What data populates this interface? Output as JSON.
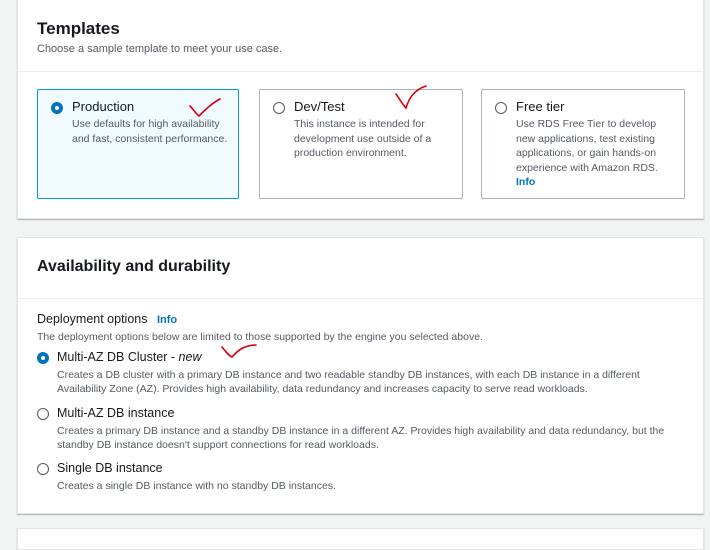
{
  "templates": {
    "title": "Templates",
    "subtitle": "Choose a sample template to meet your use case.",
    "options": [
      {
        "label": "Production",
        "description": "Use defaults for high availability and fast, consistent performance.",
        "selected": true
      },
      {
        "label": "Dev/Test",
        "description": "This instance is intended for development use outside of a production environment.",
        "selected": false
      },
      {
        "label": "Free tier",
        "description": "Use RDS Free Tier to develop new applications, test existing applications, or gain hands-on experience with Amazon RDS.",
        "info": "Info",
        "selected": false
      }
    ]
  },
  "availability": {
    "title": "Availability and durability",
    "deployment_label": "Deployment options",
    "info": "Info",
    "deployment_description": "The deployment options below are limited to those supported by the engine you selected above.",
    "options": [
      {
        "label": "Multi-AZ DB Cluster - ",
        "label_suffix": "new",
        "description": "Creates a DB cluster with a primary DB instance and two readable standby DB instances, with each DB instance in a different Availability Zone (AZ). Provides high availability, data redundancy and increases capacity to serve read workloads.",
        "selected": true
      },
      {
        "label": "Multi-AZ DB instance",
        "description": "Creates a primary DB instance and a standby DB instance in a different AZ. Provides high availability and data redundancy, but the standby DB instance doesn't support connections for read workloads.",
        "selected": false
      },
      {
        "label": "Single DB instance",
        "description": "Creates a single DB instance with no standby DB instances.",
        "selected": false
      }
    ]
  },
  "colors": {
    "accent": "#0073bb",
    "selected_tile_bg": "#f1faff",
    "selected_tile_border": "#00a1c9",
    "annotation": "#d7000f"
  }
}
